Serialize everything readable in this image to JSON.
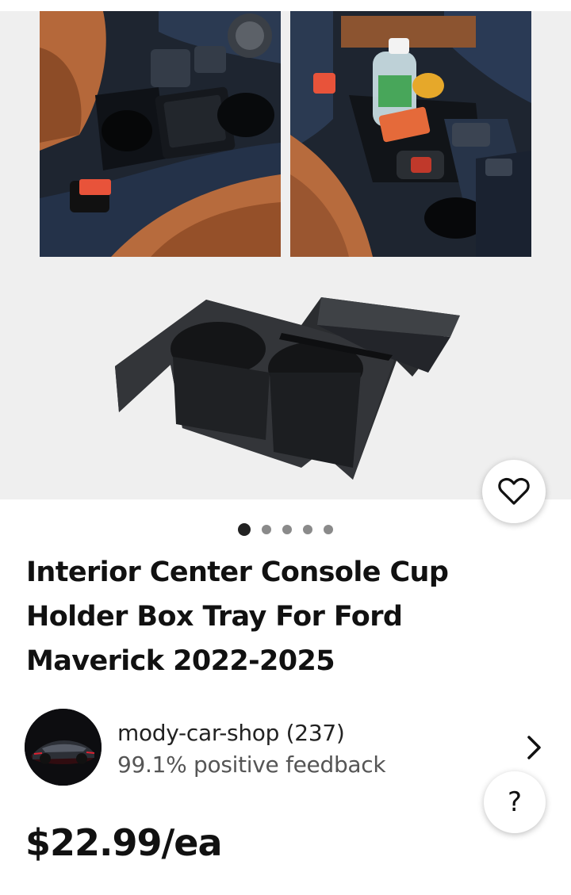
{
  "listing": {
    "title": "Interior Center Console Cup Holder Box Tray For Ford Maverick 2022-2025",
    "price": "$22.99/ea"
  },
  "gallery": {
    "image_count": 5,
    "active_index": 0
  },
  "seller": {
    "name_line": "mody-car-shop (237)",
    "feedback": "99.1% positive feedback"
  },
  "actions": {
    "watch_icon": "heart-icon",
    "help_label": "?"
  },
  "colors": {
    "gallery_bg": "#efefef",
    "active_dot": "#222222",
    "inactive_dot": "#8a8a8a"
  }
}
